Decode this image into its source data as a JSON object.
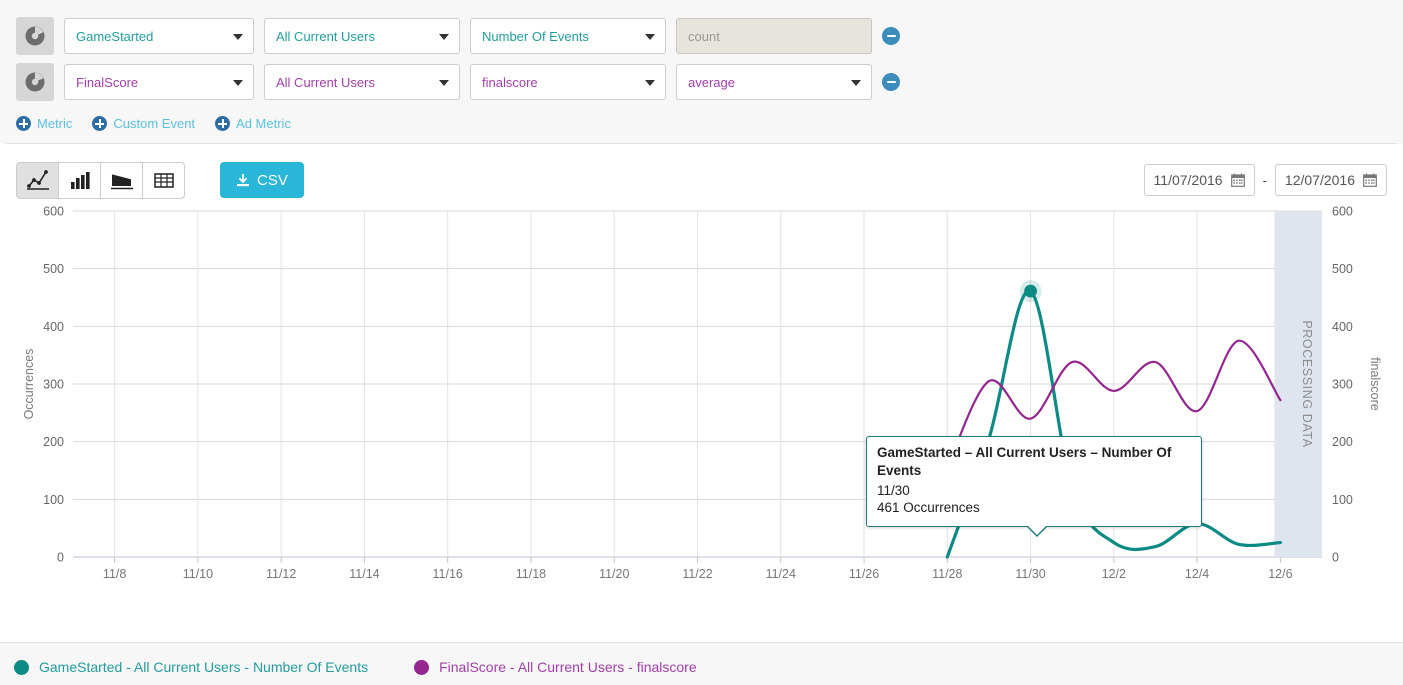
{
  "builder": {
    "rows": [
      {
        "icon": "pie-chart-icon",
        "event": "GameStarted",
        "segment": "All Current Users",
        "measure": "Number Of Events",
        "aggregate": "count",
        "aggregate_disabled": true,
        "color": "#249c9c"
      },
      {
        "icon": "pie-chart-icon",
        "event": "FinalScore",
        "segment": "All Current Users",
        "measure": "finalscore",
        "aggregate": "average",
        "aggregate_disabled": false,
        "color": "#a23fa8"
      }
    ],
    "add_links": [
      {
        "label": "Metric",
        "icon": "plus-circle-icon"
      },
      {
        "label": "Custom Event",
        "icon": "plus-circle-icon"
      },
      {
        "label": "Ad Metric",
        "icon": "plus-circle-icon"
      }
    ],
    "remove_icon": "minus-circle-icon"
  },
  "toolbar": {
    "chart_types": [
      {
        "name": "line-chart-icon",
        "active": true
      },
      {
        "name": "bar-chart-icon",
        "active": false
      },
      {
        "name": "area-chart-icon",
        "active": false
      },
      {
        "name": "table-icon",
        "active": false
      }
    ],
    "csv_label": "CSV",
    "csv_icon": "download-icon",
    "csv_color": "#29b6d8",
    "date_start": "11/07/2016",
    "date_end": "12/07/2016",
    "date_separator": "-",
    "calendar_icon": "calendar-icon"
  },
  "tooltip": {
    "title": "GameStarted – All Current Users – Number Of Events",
    "date": "11/30",
    "value": "461 Occurrences"
  },
  "processing_band": {
    "label": "PROCESSING DATA"
  },
  "legend": [
    {
      "label": "GameStarted - All Current Users - Number Of Events",
      "color": "#0c8a84"
    },
    {
      "label": "FinalScore - All Current Users - finalscore",
      "color": "#93268f"
    }
  ],
  "chart_data": {
    "type": "line",
    "title": "",
    "xlabel": "",
    "ylabel": "Occurrences",
    "y2label": "finalscore",
    "ylim": [
      0,
      600
    ],
    "y2lim": [
      0,
      600
    ],
    "yticks": [
      0,
      100,
      200,
      300,
      400,
      500,
      600
    ],
    "y2ticks": [
      0,
      100,
      200,
      300,
      400,
      500,
      600
    ],
    "xticks": [
      "11/8",
      "11/10",
      "11/12",
      "11/14",
      "11/16",
      "11/18",
      "11/20",
      "11/22",
      "11/24",
      "11/26",
      "11/28",
      "11/30",
      "12/2",
      "12/4",
      "12/6"
    ],
    "grid": true,
    "legend_position": "bottom",
    "x_domain": [
      "11/7",
      "12/7"
    ],
    "series": [
      {
        "name": "GameStarted - All Current Users - Number Of Events",
        "color": "#0c8a84",
        "axis": "left",
        "x": [
          "11/28",
          "11/29",
          "11/30",
          "12/1",
          "12/2",
          "12/3",
          "12/4",
          "12/5",
          "12/6"
        ],
        "values": [
          0,
          205,
          461,
          120,
          25,
          18,
          58,
          22,
          25
        ]
      },
      {
        "name": "FinalScore - All Current Users - finalscore",
        "color": "#93268f",
        "axis": "right",
        "x": [
          "11/28",
          "11/29",
          "11/30",
          "12/1",
          "12/2",
          "12/3",
          "12/4",
          "12/5",
          "12/6"
        ],
        "values": [
          155,
          305,
          240,
          338,
          288,
          338,
          253,
          375,
          272
        ]
      }
    ],
    "highlight_point": {
      "series": "GameStarted - All Current Users - Number Of Events",
      "x": "11/30",
      "y": 461
    }
  }
}
